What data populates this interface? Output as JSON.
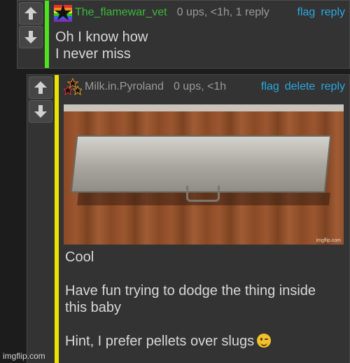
{
  "comments": [
    {
      "username": "The_flamewar_vet",
      "meta": "0 ups, <1h, 1 reply",
      "actions": [
        "flag",
        "reply"
      ],
      "lines": [
        "Oh I know how",
        "I never miss"
      ]
    },
    {
      "username": "Milk.in.Pyroland",
      "meta": "0 ups, <1h",
      "actions": [
        "flag",
        "delete",
        "reply"
      ],
      "lines": [
        "Cool",
        "Have fun trying to dodge the thing inside",
        "this baby",
        "Hint, I prefer pellets over slugs"
      ],
      "image_tag": "imgflip.com"
    }
  ],
  "watermark": "imgflip.com",
  "colors": {
    "accent_green": "#4ee21f",
    "accent_yellow": "#e8e400",
    "link": "#2aa8e0"
  }
}
